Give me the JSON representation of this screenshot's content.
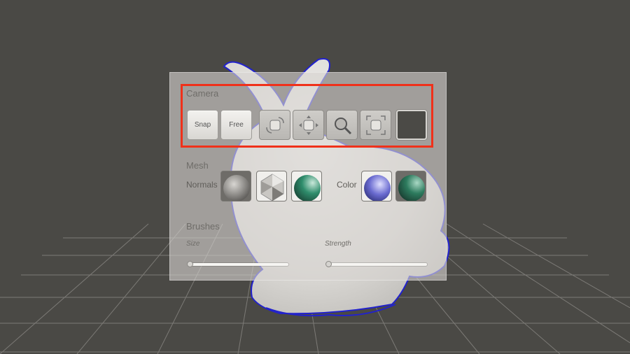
{
  "panel": {
    "camera": {
      "title": "Camera",
      "snap_label": "Snap",
      "free_label": "Free",
      "tools": [
        "rotate-icon",
        "pan-icon",
        "zoom-icon",
        "frame-icon"
      ],
      "swatch_color": "#4b4a46"
    },
    "mesh": {
      "title": "Mesh",
      "normals_label": "Normals",
      "color_label": "Color",
      "normals_materials": [
        "matcap-clay",
        "matcap-faceted",
        "matcap-green"
      ],
      "color_materials": [
        "matcap-blue",
        "matcap-green"
      ]
    },
    "brushes": {
      "title": "Brushes",
      "size_label": "Size",
      "strength_label": "Strength",
      "size_value": 0,
      "strength_value": 0
    }
  },
  "colors": {
    "background": "#4a4945",
    "highlight": "#f0311a",
    "outline": "#2222cc"
  }
}
